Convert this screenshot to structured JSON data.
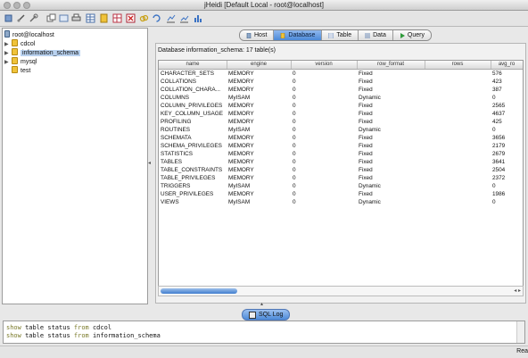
{
  "window": {
    "title": "jHeidi [Default Local - root@localhost]"
  },
  "toolbar_icons": [
    "new-connection-icon",
    "disconnect-icon",
    "tools-icon",
    "copy-icon",
    "export-icon",
    "print-icon",
    "table-icon",
    "database-icon",
    "grid-icon",
    "delete-icon",
    "link-icon",
    "refresh-icon",
    "chart-icon",
    "chart-alt-icon",
    "chart-bar-icon"
  ],
  "tree": {
    "root": "root@localhost",
    "databases": [
      "cdcol",
      "information_schema",
      "mysql",
      "test"
    ],
    "selected": "information_schema"
  },
  "tabs": [
    "Host",
    "Database",
    "Table",
    "Data",
    "Query"
  ],
  "active_tab": "Database",
  "panel": {
    "status": "Database information_schema: 17 table(s)",
    "columns": [
      "name",
      "engine",
      "version",
      "row_format",
      "rows",
      "avg_ro"
    ],
    "rows": [
      [
        "CHARACTER_SETS",
        "MEMORY",
        "0",
        "Fixed",
        "",
        "576"
      ],
      [
        "COLLATIONS",
        "MEMORY",
        "0",
        "Fixed",
        "",
        "423"
      ],
      [
        "COLLATION_CHARA...",
        "MEMORY",
        "0",
        "Fixed",
        "",
        "387"
      ],
      [
        "COLUMNS",
        "MyISAM",
        "0",
        "Dynamic",
        "",
        "0"
      ],
      [
        "COLUMN_PRIVILEGES",
        "MEMORY",
        "0",
        "Fixed",
        "",
        "2565"
      ],
      [
        "KEY_COLUMN_USAGE",
        "MEMORY",
        "0",
        "Fixed",
        "",
        "4637"
      ],
      [
        "PROFILING",
        "MEMORY",
        "0",
        "Fixed",
        "",
        "425"
      ],
      [
        "ROUTINES",
        "MyISAM",
        "0",
        "Dynamic",
        "",
        "0"
      ],
      [
        "SCHEMATA",
        "MEMORY",
        "0",
        "Fixed",
        "",
        "3656"
      ],
      [
        "SCHEMA_PRIVILEGES",
        "MEMORY",
        "0",
        "Fixed",
        "",
        "2179"
      ],
      [
        "STATISTICS",
        "MEMORY",
        "0",
        "Fixed",
        "",
        "2679"
      ],
      [
        "TABLES",
        "MEMORY",
        "0",
        "Fixed",
        "",
        "3641"
      ],
      [
        "TABLE_CONSTRAINTS",
        "MEMORY",
        "0",
        "Fixed",
        "",
        "2504"
      ],
      [
        "TABLE_PRIVILEGES",
        "MEMORY",
        "0",
        "Fixed",
        "",
        "2372"
      ],
      [
        "TRIGGERS",
        "MyISAM",
        "0",
        "Dynamic",
        "",
        "0"
      ],
      [
        "USER_PRIVILEGES",
        "MEMORY",
        "0",
        "Fixed",
        "",
        "1986"
      ],
      [
        "VIEWS",
        "MyISAM",
        "0",
        "Dynamic",
        "",
        "0"
      ]
    ],
    "scroll_arrows": "◂ ▸"
  },
  "sql_log": {
    "tab_label": "SQL Log",
    "lines": [
      {
        "keyword1": "show",
        "word1": "table",
        "keyword2": "status",
        "word2": "",
        "keyword3": "from",
        "obj": "cdcol"
      },
      {
        "keyword1": "show",
        "word1": "table",
        "keyword2": "status",
        "word2": "",
        "keyword3": "from",
        "obj": "information_schema"
      }
    ]
  },
  "statusbar": {
    "text": "Rea"
  }
}
